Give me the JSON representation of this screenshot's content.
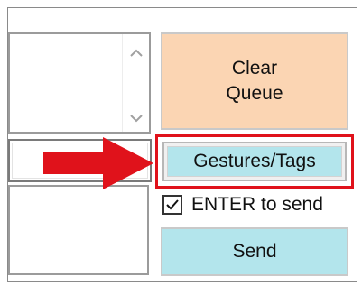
{
  "buttons": {
    "clear_queue_label": "Clear\nQueue",
    "gestures_tags_label": "Gestures/Tags",
    "send_label": "Send"
  },
  "options": {
    "enter_to_send_label": "ENTER to send",
    "enter_to_send_checked": true
  },
  "colors": {
    "clear_queue_bg": "#fbd5b3",
    "action_button_bg": "#b3e5ec",
    "highlight_red": "#e0121b"
  },
  "icons": {
    "scroll_up": "chevron-up-icon",
    "scroll_down": "chevron-down-icon",
    "pointer": "red-arrow-icon",
    "checkmark": "checkmark-icon"
  }
}
